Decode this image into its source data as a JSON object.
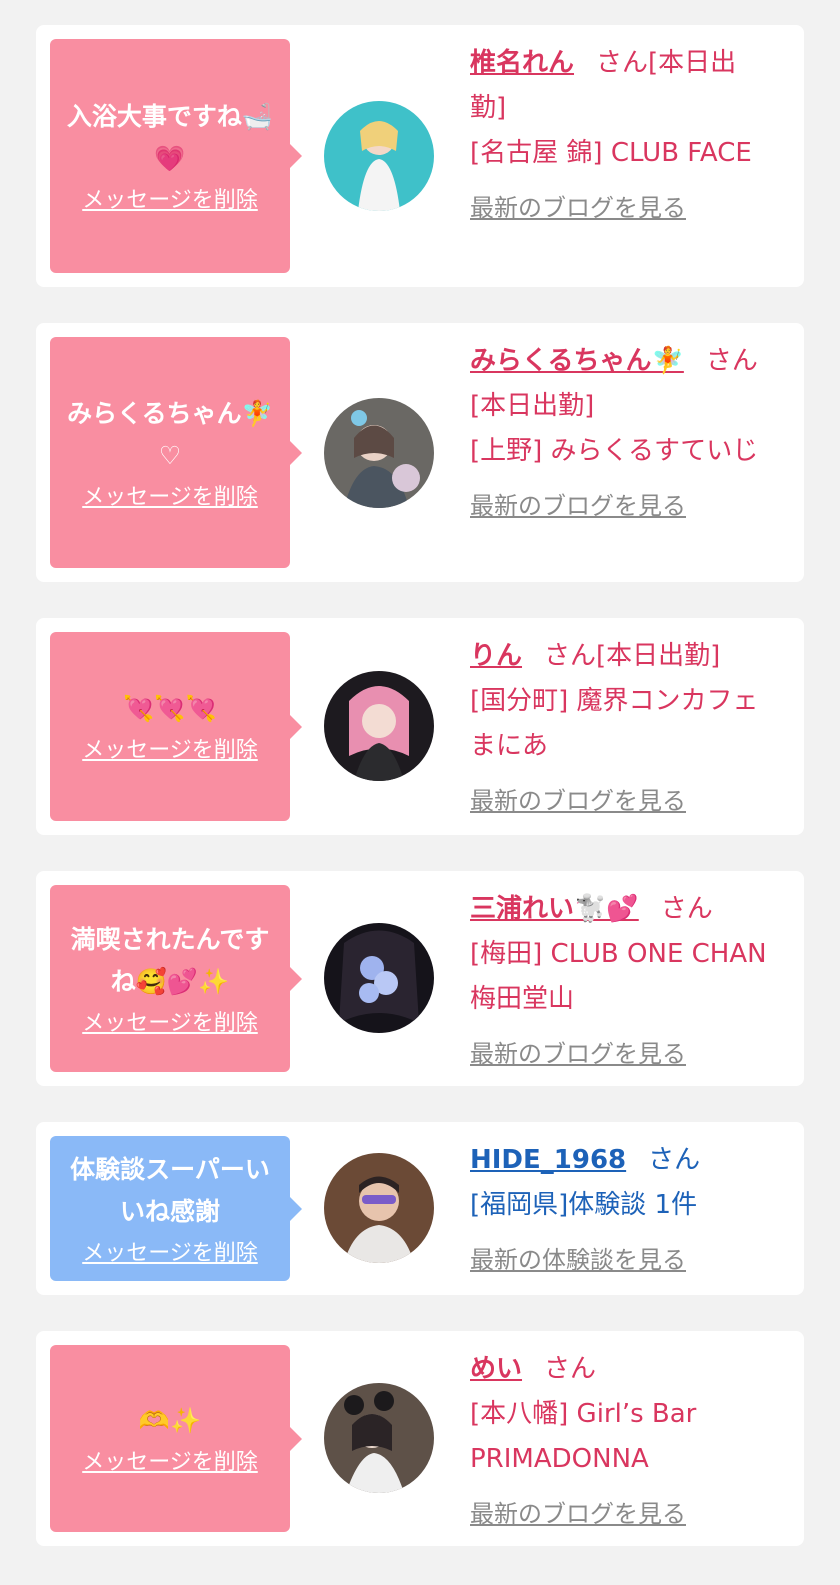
{
  "delete_label": "メッセージを削除",
  "cards": [
    {
      "message": "入浴大事ですね🛁💗",
      "name": "椎名れん",
      "san_line": "さん[本日出勤]",
      "shop": "[名古屋 錦] CLUB FACE",
      "link": "最新のブログを見る",
      "bubble_color": "#f98ea1"
    },
    {
      "message": "みらくるちゃん🧚♡",
      "name": "みらくるちゃん🧚",
      "san_line": "さん[本日出勤]",
      "shop": "[上野] みらくるすていじ",
      "link": "最新のブログを見る",
      "bubble_color": "#f98ea1"
    },
    {
      "message": "💘💘💘",
      "name": "りん",
      "san_line": "さん[本日出勤]",
      "shop": "[国分町] 魔界コンカフェ まにあ",
      "link": "最新のブログを見る",
      "bubble_color": "#f98ea1"
    },
    {
      "message": "満喫されたんですね🥰💕✨",
      "name": "三浦れい🐩💕",
      "san_line": "さん",
      "shop": "[梅田] CLUB ONE CHAN 梅田堂山",
      "link": "最新のブログを見る",
      "bubble_color": "#f98ea1"
    },
    {
      "message": "体験談スーパーいいね感謝",
      "name": "HIDE_1968",
      "san_line": "さん",
      "shop": "[福岡県]体験談 1件",
      "link": "最新の体験談を見る",
      "bubble_color": "#8ab9f7"
    },
    {
      "message": "🫶✨",
      "name": "めい",
      "san_line": "さん",
      "shop": "[本八幡] Girl’s Bar PRIMADONNA",
      "link": "最新のブログを見る",
      "bubble_color": "#f98ea1"
    }
  ],
  "colors": {
    "accent_pink": "#d9365f",
    "accent_blue": "#1d62b8",
    "bubble_pink": "#f98ea1",
    "bubble_blue": "#8ab9f7",
    "background": "#f2f2f2"
  }
}
